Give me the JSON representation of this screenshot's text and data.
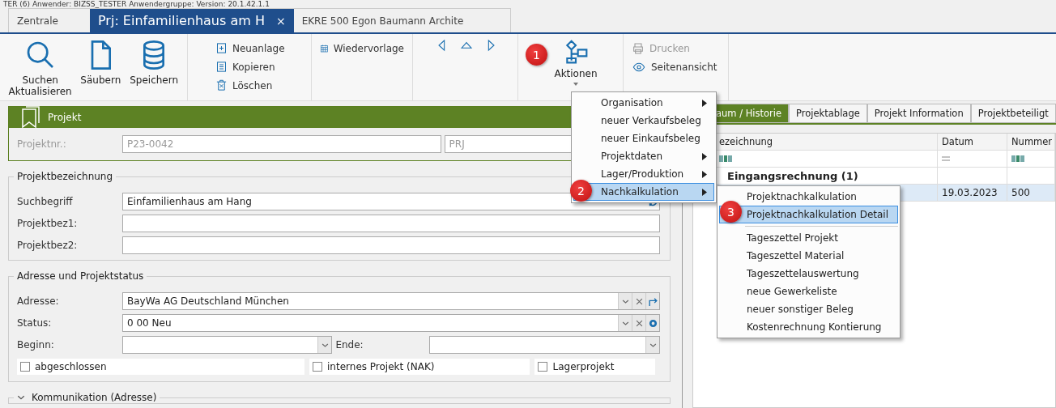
{
  "status_line": "TER (6)  Anwender: BIZSS_TESTER  Anwendergruppe:      Version: 20.1.42.1.1",
  "doc_tabs": [
    {
      "label": "Zentrale",
      "selected": false
    },
    {
      "label": "Prj: Einfamilienhaus am H",
      "selected": true,
      "close": "×"
    },
    {
      "label": "EKRE 500 Egon Baumann Archite",
      "selected": false
    }
  ],
  "ribbon": {
    "big_buttons": [
      {
        "kind": "search",
        "label": "Suchen Aktualisieren"
      },
      {
        "kind": "page",
        "label": "Säubern"
      },
      {
        "kind": "database",
        "label": "Speichern"
      }
    ],
    "small_buttons": [
      {
        "kind": "add",
        "label": "Neuanlage"
      },
      {
        "kind": "copy",
        "label": "Kopieren"
      },
      {
        "kind": "delete",
        "label": "Löschen"
      }
    ],
    "resubmit": {
      "label": "Wiedervorlage"
    },
    "actions": {
      "label": "Aktionen"
    },
    "print": [
      {
        "kind": "print",
        "label": "Drucken",
        "disabled": true
      },
      {
        "kind": "preview",
        "label": "Seitenansicht",
        "disabled": false
      }
    ]
  },
  "project": {
    "title": "Projekt",
    "number_label": "Projektnr.:",
    "number": "P23-0042",
    "type": "PRJ"
  },
  "designation": {
    "title": "Projektbezeichnung",
    "fields": [
      {
        "label": "Suchbegriff",
        "value": "Einfamilienhaus am Hang",
        "kind": "refresh"
      },
      {
        "label": "Projektbez1:",
        "kind": "plain"
      },
      {
        "label": "Projektbez2:",
        "kind": "plain"
      }
    ]
  },
  "address": {
    "title": "Adresse und Projektstatus",
    "fields": [
      {
        "label": "Adresse:",
        "value": "BayWa AG Deutschland München",
        "kind": "goto"
      },
      {
        "label": "Status:",
        "value": "0 00 Neu",
        "kind": "settings"
      }
    ],
    "start_label": "Beginn:",
    "end_label": "Ende:",
    "checks": [
      {
        "label": "abgeschlossen",
        "checked": false
      },
      {
        "label": "internes Projekt (NAK)",
        "checked": false
      },
      {
        "label": "Lagerprojekt",
        "checked": false
      }
    ]
  },
  "communication": {
    "title": "Kommunikation (Adresse)",
    "expanded": false
  },
  "right_tabs": [
    {
      "label": "aum / Historie",
      "selected": true
    },
    {
      "label": "Projektablage",
      "selected": false
    },
    {
      "label": "Projekt Information",
      "selected": false
    },
    {
      "label": "Projektbeteiligt",
      "selected": false
    }
  ],
  "grid": {
    "columns": [
      "ezeichnung",
      "Datum",
      "Nummer"
    ],
    "filter": [
      {
        "kind": "text"
      },
      {
        "kind": "equals"
      },
      {
        "kind": "text"
      }
    ],
    "group": "Eingangsrechnung (1)",
    "rows": [
      {
        "date": "19.03.2023",
        "number": "500",
        "selected": true
      }
    ]
  },
  "menu": [
    {
      "label": "Organisation",
      "submenu": true,
      "selected": false
    },
    {
      "label": "neuer Verkaufsbeleg",
      "submenu": false,
      "selected": false
    },
    {
      "label": "neuer Einkaufsbeleg",
      "submenu": false,
      "selected": false
    },
    {
      "label": "Projektdaten",
      "submenu": true,
      "selected": false
    },
    {
      "label": "Lager/Produktion",
      "submenu": true,
      "selected": false
    },
    {
      "label": "Nachkalkulation",
      "submenu": true,
      "selected": true
    }
  ],
  "submenu": [
    {
      "kind": "item",
      "label": "Projektnachkalkulation",
      "selected": false
    },
    {
      "kind": "item",
      "label": "Projektnachkalkulation Detail",
      "selected": true
    },
    {
      "kind": "separator"
    },
    {
      "kind": "item",
      "label": "Tageszettel Projekt",
      "selected": false
    },
    {
      "kind": "item",
      "label": "Tageszettel Material",
      "selected": false
    },
    {
      "kind": "item",
      "label": "Tageszettelauswertung",
      "selected": false
    },
    {
      "kind": "item",
      "label": "neue Gewerkeliste",
      "selected": false
    },
    {
      "kind": "item",
      "label": "neuer sonstiger Beleg",
      "selected": false
    },
    {
      "kind": "item",
      "label": "Kostenrechnung Kontierung",
      "selected": false
    }
  ],
  "step_badges": [
    "1",
    "2",
    "3"
  ]
}
